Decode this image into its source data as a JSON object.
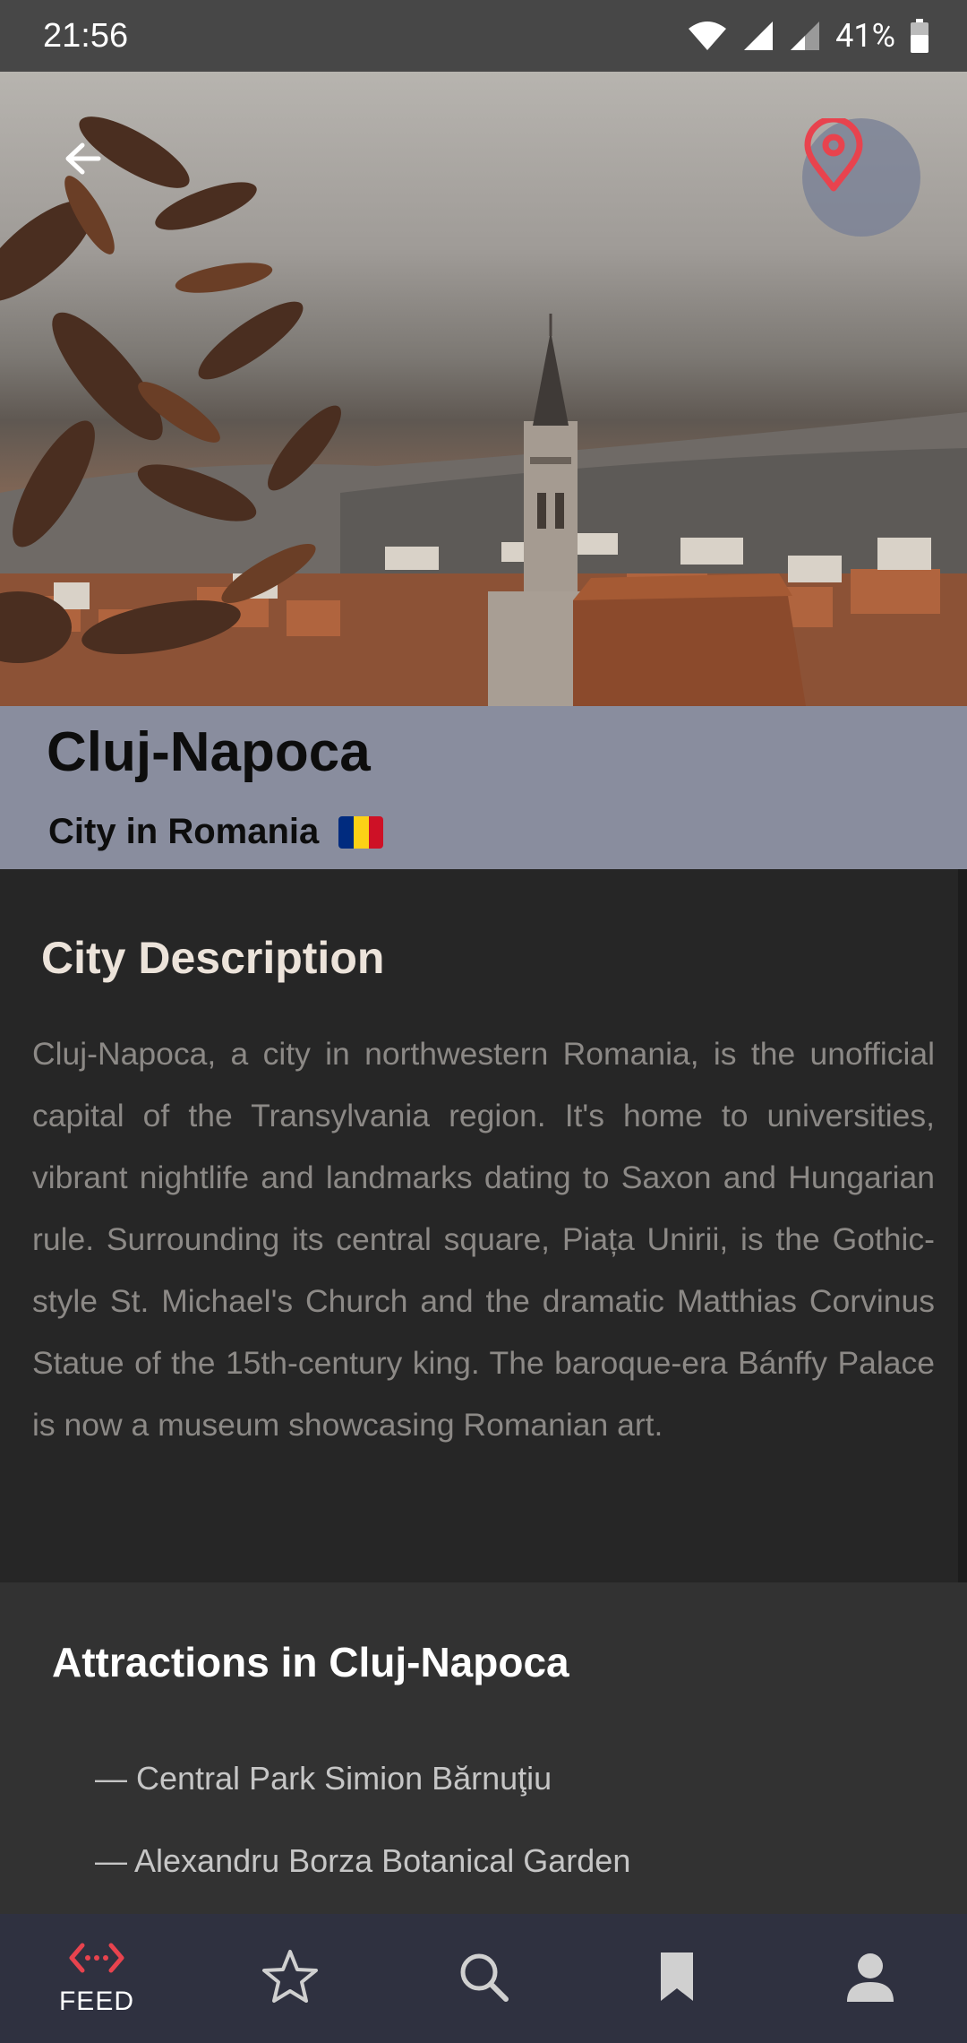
{
  "status_bar": {
    "time": "21:56",
    "battery_percent": "41%",
    "icons": [
      "wifi-icon",
      "signal-icon",
      "signal-weak-icon",
      "battery-icon"
    ]
  },
  "hero": {
    "back_icon": "back-arrow-icon",
    "location_icon": "map-pin-icon",
    "accent_color": "#e8434e"
  },
  "city": {
    "name": "Cluj-Napoca",
    "subtitle": "City in Romania",
    "flag_colors": [
      "#002b7f",
      "#fcd116",
      "#ce1126"
    ]
  },
  "description": {
    "heading": "City Description",
    "text": "Cluj-Napoca, a city in northwestern Romania, is the unofficial capital of the Transylvania region. It's home to universities, vibrant nightlife and landmarks dating to Saxon and Hungarian rule. Surrounding its central square, Piața Unirii, is the Gothic-style St. Michael's Church and the dramatic Matthias Corvinus Statue of the 15th-century king. The baroque-era Bánffy Palace is now a museum showcasing Romanian art."
  },
  "attractions": {
    "heading": "Attractions in Cluj-Napoca",
    "items": [
      "— Central Park Simion Bărnuţiu",
      "— Alexandru Borza Botanical Garden"
    ]
  },
  "bottom_nav": {
    "items": [
      {
        "icon": "feed-code-icon",
        "label": "FEED",
        "active": true
      },
      {
        "icon": "star-icon",
        "label": ""
      },
      {
        "icon": "search-icon",
        "label": ""
      },
      {
        "icon": "bookmark-icon",
        "label": ""
      },
      {
        "icon": "profile-icon",
        "label": ""
      }
    ],
    "active_color": "#e8434e"
  }
}
